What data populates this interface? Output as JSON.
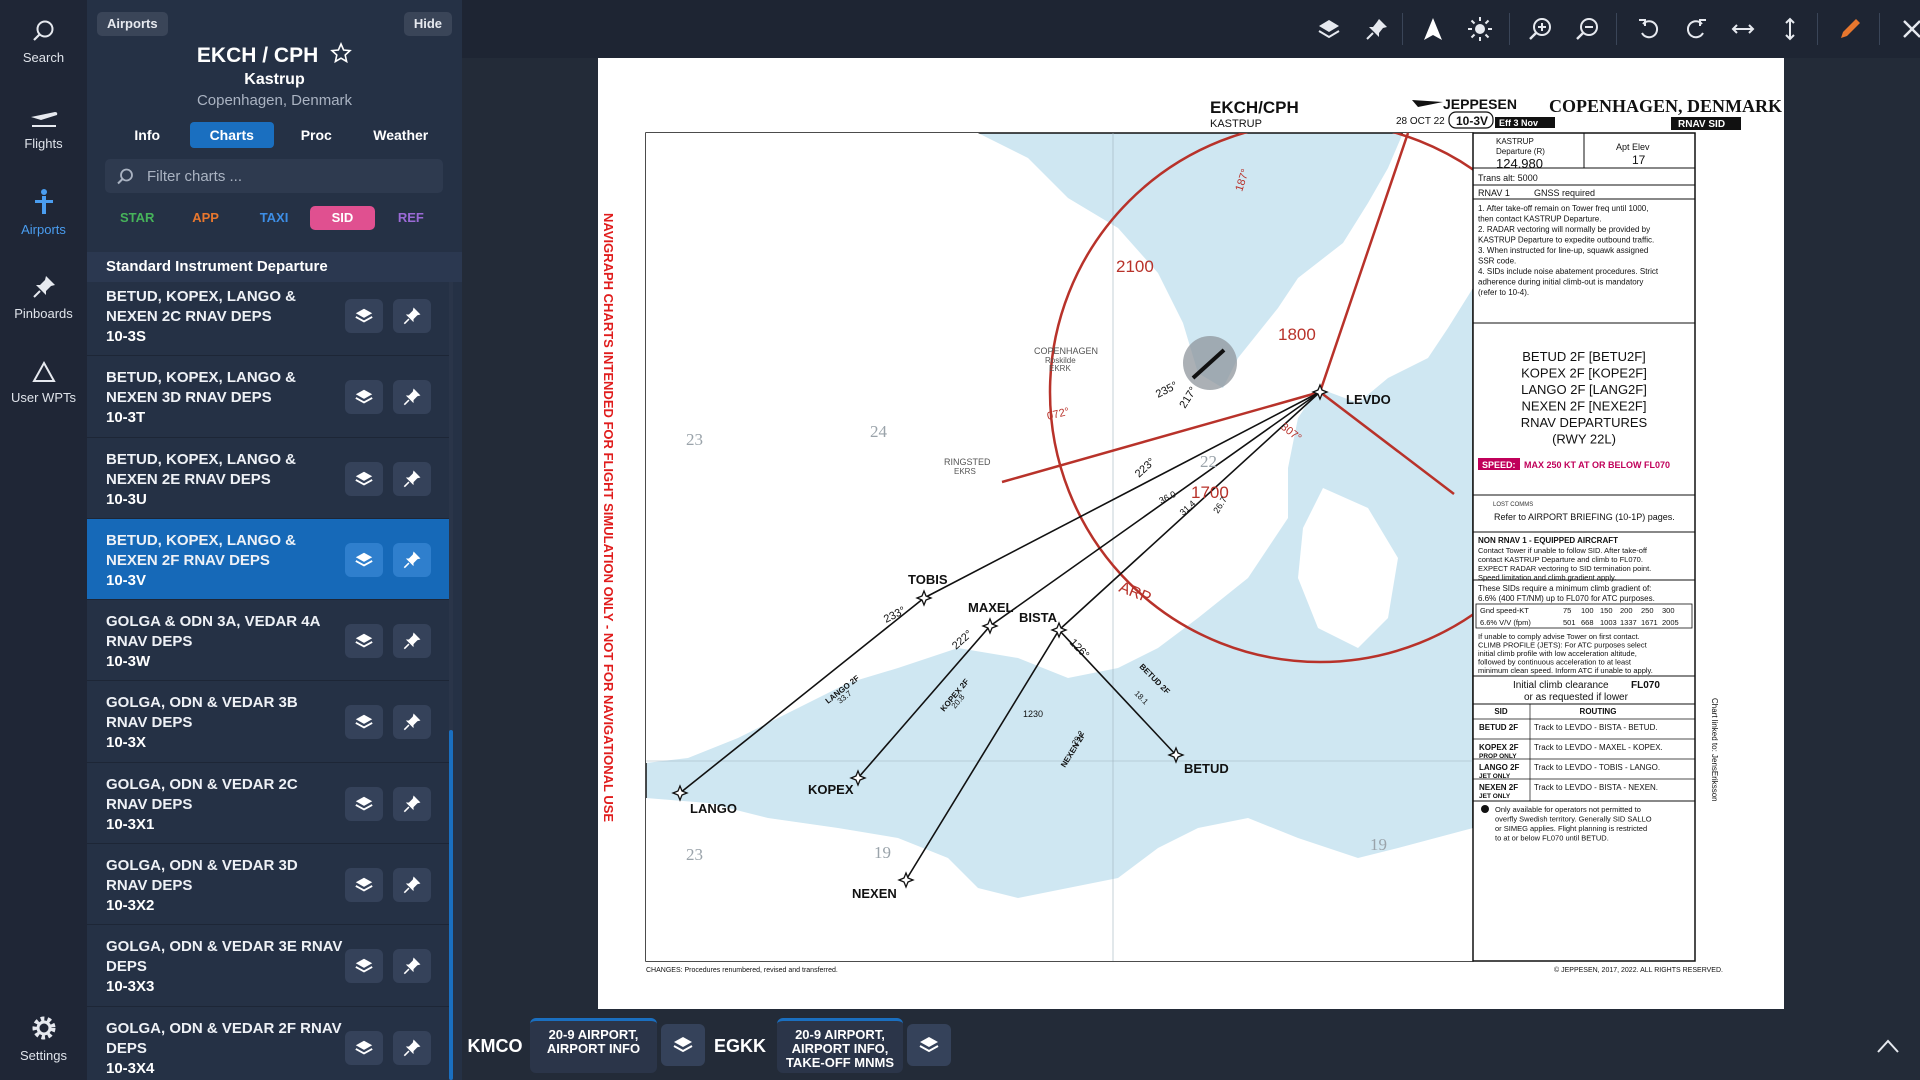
{
  "rail": {
    "items": [
      {
        "label": "Search",
        "icon": "search-icon"
      },
      {
        "label": "Flights",
        "icon": "plane-icon"
      },
      {
        "label": "Airports",
        "icon": "airport-icon"
      },
      {
        "label": "Pinboards",
        "icon": "pin-icon"
      },
      {
        "label": "User WPTs",
        "icon": "triangle-icon"
      },
      {
        "label": "Settings",
        "icon": "gear-icon"
      }
    ]
  },
  "panel": {
    "chip_left": "Airports",
    "chip_right": "Hide",
    "airport_title": "EKCH / CPH",
    "airport_name": "Kastrup",
    "airport_location": "Copenhagen, Denmark",
    "tabs": [
      "Info",
      "Charts",
      "Proc",
      "Weather"
    ],
    "active_tab": "Charts",
    "filter_placeholder": "Filter charts ...",
    "types": [
      {
        "label": "STAR",
        "color": "#46b35a"
      },
      {
        "label": "APP",
        "color": "#e8772e"
      },
      {
        "label": "TAXI",
        "color": "#3d8ee6"
      },
      {
        "label": "SID",
        "color": "#e05090"
      },
      {
        "label": "REF",
        "color": "#9b6ad6"
      }
    ],
    "active_type": "SID",
    "section": "Standard Instrument Departure",
    "charts": [
      {
        "title": "BETUD, KOPEX, LANGO & NEXEN 2C RNAV DEPS",
        "code": "10-3S"
      },
      {
        "title": "BETUD, KOPEX, LANGO & NEXEN 3D RNAV DEPS",
        "code": "10-3T"
      },
      {
        "title": "BETUD, KOPEX, LANGO & NEXEN 2E RNAV DEPS",
        "code": "10-3U"
      },
      {
        "title": "BETUD, KOPEX, LANGO & NEXEN 2F RNAV DEPS",
        "code": "10-3V"
      },
      {
        "title": "GOLGA & ODN 3A, VEDAR 4A RNAV DEPS",
        "code": "10-3W"
      },
      {
        "title": "GOLGA, ODN & VEDAR 3B RNAV DEPS",
        "code": "10-3X"
      },
      {
        "title": "GOLGA, ODN & VEDAR 2C RNAV DEPS",
        "code": "10-3X1"
      },
      {
        "title": "GOLGA, ODN & VEDAR 3D RNAV DEPS",
        "code": "10-3X2"
      },
      {
        "title": "GOLGA, ODN & VEDAR 3E RNAV DEPS",
        "code": "10-3X3"
      },
      {
        "title": "GOLGA, ODN & VEDAR 2F RNAV DEPS",
        "code": "10-3X4"
      }
    ],
    "active_chart_index": 3
  },
  "toolbar": {
    "icons": [
      "layers-icon",
      "pin-icon",
      "north-up-icon",
      "brightness-icon",
      "zoom-in-icon",
      "zoom-out-icon",
      "rotate-left-icon",
      "rotate-right-icon",
      "fit-width-icon",
      "fit-height-icon",
      "pencil-icon",
      "close-icon"
    ]
  },
  "chart": {
    "airport_code": "EKCH/CPH",
    "airport_sub": "KASTRUP",
    "publisher": "JEPPESEN",
    "date": "28 OCT 22",
    "chart_number": "10-3V",
    "effective": "Eff 3 Nov",
    "city": "COPENHAGEN, DENMARK",
    "chart_kind": "RNAV SID",
    "disclaimer": "NAVIGRAPH CHARTS INTENDED FOR FLIGHT SIMULATION ONLY - NOT FOR NAVIGATIONAL USE",
    "freq_label1": "KASTRUP",
    "freq_label2": "Departure (R)",
    "freq": "124.980",
    "elev_label": "Apt Elev",
    "elev": "17",
    "trans_alt": "Trans alt: 5000",
    "rnav": "RNAV 1",
    "gnss": "GNSS required",
    "notes": [
      "1. After take-off remain on Tower freq until 1000,",
      "then contact KASTRUP Departure.",
      "2. RADAR vectoring will normally be provided by",
      "KASTRUP Departure to expedite outbound traffic.",
      "3. When instructed for line-up, squawk assigned",
      "SSR code.",
      "4. SIDs include noise abatement procedures. Strict",
      "adherence during initial climb-out is mandatory",
      "(refer to 10-4)."
    ],
    "procedures": [
      "BETUD 2F [BETU2F]",
      "KOPEX 2F [KOPE2F]",
      "LANGO 2F [LANG2F]",
      "NEXEN 2F [NEXE2F]",
      "RNAV DEPARTURES",
      "(RWY 22L)"
    ],
    "speed_label": "SPEED:",
    "speed_text": "MAX 250 KT AT OR BELOW FL070",
    "lost_comms": "LOST COMMS",
    "briefing_ref": "Refer to AIRPORT BRIEFING (10-1P) pages.",
    "non_rnav_title": "NON RNAV 1 - EQUIPPED AIRCRAFT",
    "non_rnav": [
      "Contact Tower if unable to follow SID. After take-off",
      "contact KASTRUP Departure and climb to FL070.",
      "EXPECT RADAR vectoring to SID termination point.",
      "Speed limitation and climb gradient apply."
    ],
    "gradient_text": [
      "These SIDs require a minimum climb gradient of:",
      "6.6% (400 FT/NM) up to FL070 for ATC purposes."
    ],
    "gradient_table": {
      "row1": [
        "Gnd speed-KT",
        "75",
        "100",
        "150",
        "200",
        "250",
        "300"
      ],
      "row2": [
        "6.6% V/V (fpm)",
        "501",
        "668",
        "1003",
        "1337",
        "1671",
        "2005"
      ]
    },
    "climb_notes": [
      "If unable to comply advise Tower on first contact.",
      "CLIMB PROFILE (JETS): For ATC purposes select",
      "initial climb profile with low acceleration altitude,",
      "followed by continuous acceleration to at least",
      "minimum clean speed. Inform ATC if unable to apply."
    ],
    "initial_climb": "Initial climb clearance",
    "initial_climb_value": "FL070",
    "initial_climb_alt": "or as requested if lower",
    "routing_header": [
      "SID",
      "ROUTING"
    ],
    "routings": [
      {
        "sid": "BETUD 2F",
        "sub": "",
        "route": "Track to LEVDO - BISTA - BETUD."
      },
      {
        "sid": "KOPEX 2F",
        "sub": "PROP ONLY",
        "route": "Track to LEVDO - MAXEL - KOPEX."
      },
      {
        "sid": "LANGO 2F",
        "sub": "JET ONLY",
        "route": "Track to LEVDO - TOBIS - LANGO."
      },
      {
        "sid": "NEXEN 2F",
        "sub": "JET ONLY",
        "route": "Track to LEVDO - BISTA - NEXEN."
      }
    ],
    "footnote": [
      "Only available for operators not permitted to",
      "overfly Swedish territory. Generally SID SALLO",
      "or SIMEG applies. Flight planning is restricted",
      "to at or below FL070 until BETUD."
    ],
    "changes": "CHANGES: Procedures renumbered, revised and transferred.",
    "copyright": "© JEPPESEN, 2017, 2022. ALL RIGHTS RESERVED.",
    "side_note": "Chart linked to: JensEriksson",
    "waypoints": [
      "LEVDO",
      "TOBIS",
      "MAXEL",
      "BISTA",
      "LANGO",
      "KOPEX",
      "NEXEN",
      "BETUD"
    ],
    "msa": [
      "2100",
      "1800",
      "1700"
    ],
    "bearings": [
      "187°",
      "072°",
      "307°",
      "235°",
      "217°",
      "223°",
      "233°",
      "222°",
      "126°"
    ],
    "distances": [
      "36.0",
      "31.4",
      "26.7",
      "33.7",
      "20.8",
      "29.2",
      "18.1"
    ],
    "leg_labels": [
      "LANGO 2F",
      "KOPEX 2F",
      "NEXEN 2F",
      "BETUD 2F"
    ],
    "place_labels": [
      "COPENHAGEN",
      "Roskilde",
      "EKRK",
      "RINGSTED",
      "EKRS"
    ],
    "arp": "ARP",
    "elevation_spot": "1230",
    "grid_labels": [
      "23",
      "24",
      "22",
      "19",
      "19",
      "23"
    ]
  },
  "dock": {
    "items": [
      {
        "code": "KMCO",
        "card": "20-9 AIRPORT, AIRPORT INFO"
      },
      {
        "code": "EGKK",
        "card": "20-9 AIRPORT, AIRPORT INFO, TAKE-OFF MNMS"
      }
    ]
  }
}
